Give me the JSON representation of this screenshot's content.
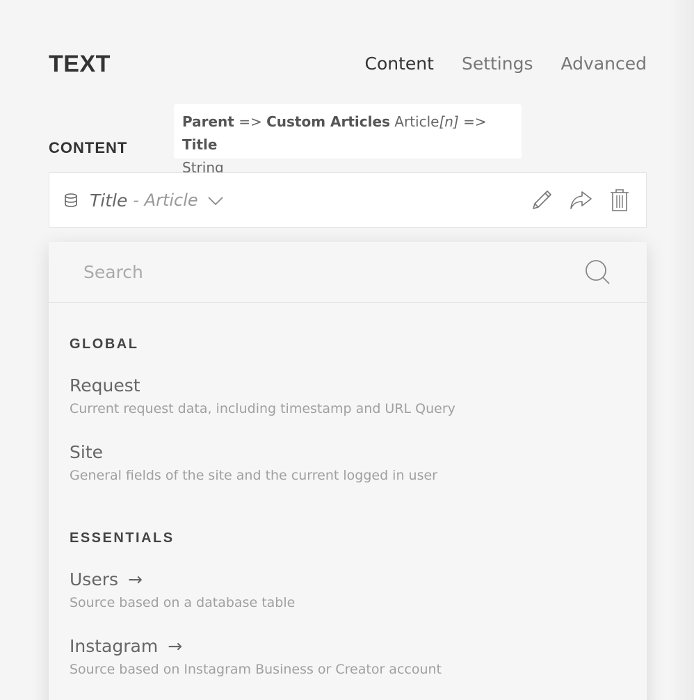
{
  "panel": {
    "title": "TEXT",
    "tabs": [
      {
        "label": "Content"
      },
      {
        "label": "Settings"
      },
      {
        "label": "Advanced"
      }
    ]
  },
  "content_section": {
    "label": "CONTENT",
    "tooltip": {
      "parent": "Parent",
      "arrow1": " => ",
      "source": "Custom Articles",
      "type_prefix": " Article",
      "index": "[n]",
      "arrow2": " => ",
      "field": "Title",
      "datatype": "String"
    },
    "field": {
      "value": "Title",
      "sub": "- Article"
    }
  },
  "dropdown": {
    "search_placeholder": "Search",
    "groups": [
      {
        "heading": "GLOBAL",
        "items": [
          {
            "title": "Request",
            "desc": "Current request data, including timestamp and URL Query"
          },
          {
            "title": "Site",
            "desc": "General fields of the site and the current logged in user"
          }
        ]
      },
      {
        "heading": "ESSENTIALS",
        "items": [
          {
            "title": "Users",
            "arrow": "→",
            "desc": "Source based on a database table"
          },
          {
            "title": "Instagram",
            "arrow": "→",
            "desc": "Source based on Instagram Business or Creator account"
          }
        ]
      }
    ]
  }
}
